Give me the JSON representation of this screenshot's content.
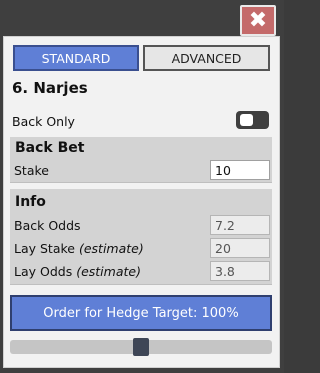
{
  "window": {
    "close_icon": "close-icon",
    "close_glyph": "✖"
  },
  "tabs": [
    {
      "label": "STANDARD",
      "active": true
    },
    {
      "label": "ADVANCED",
      "active": false
    }
  ],
  "title": "6. Narjes",
  "back_only": {
    "label": "Back Only",
    "enabled": false
  },
  "back_bet": {
    "title": "Back Bet",
    "stake_label": "Stake",
    "stake_value": "10"
  },
  "info": {
    "title": "Info",
    "back_odds_label": "Back Odds",
    "back_odds_value": "7.2",
    "lay_stake_label": "Lay Stake",
    "lay_stake_note": "(estimate)",
    "lay_stake_value": "20",
    "lay_odds_label": "Lay Odds",
    "lay_odds_note": "(estimate)",
    "lay_odds_value": "3.8"
  },
  "order_button": "Order for Hedge Target: 100%",
  "hedge_slider": {
    "value_percent": 100,
    "position_fraction": 0.5
  },
  "colors": {
    "accent": "#5f7fd6",
    "close": "#c46a6a",
    "background": "#3f3f3f",
    "section": "#d3d3d3"
  }
}
